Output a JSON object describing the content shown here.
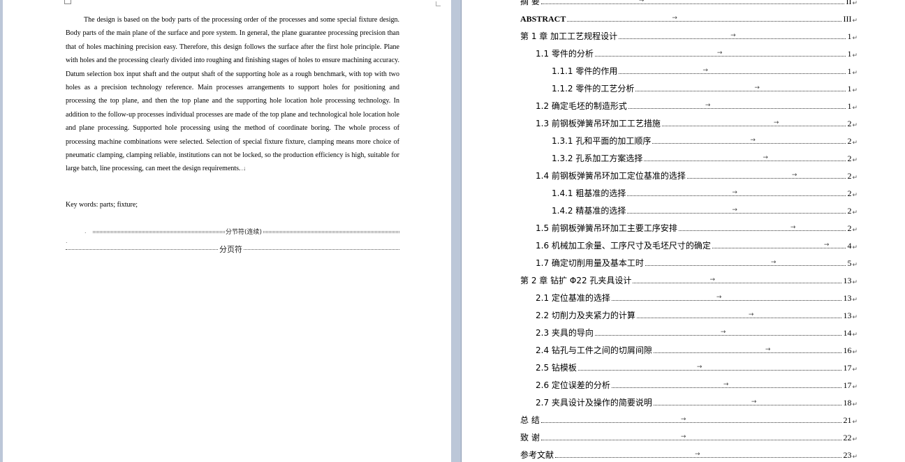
{
  "abstract": {
    "text": "The design is based on the body parts of the processing order of the processes and some special fixture design. Body parts of the main plane of the surface and pore system. In general, the plane guarantee processing precision than that of holes machining precision easy. Therefore, this design follows the surface after the first hole principle. Plane with holes and the processing clearly divided into roughing and finishing stages of holes to ensure machining accuracy. Datum selection box input shaft and the output shaft of the supporting hole as a rough benchmark, with top with two holes as a precision technology reference. Main processes arrangements to support holes for positioning and processing the top plane, and then the top plane and the supporting hole location hole processing technology. In addition to the follow-up processes individual processes are made of the top plane and technological hole location hole and plane processing. Supported hole processing using the method of coordinate boring. The whole process of processing machine combinations were selected. Selection of special fixture fixture, clamping means more choice of pneumatic clamping, clamping reliable, institutions can not be locked, so the production efficiency is high, suitable for large batch, line processing, can meet the design requirements.",
    "end_mark": ".↓"
  },
  "keywords": {
    "text": "Key words:   parts; fixture;"
  },
  "breaks": {
    "section_break": "分节符(连续)",
    "page_break": "分页符"
  },
  "toc": [
    {
      "label": "摘  要",
      "page": "II",
      "indent": 0,
      "bold": false
    },
    {
      "label": "ABSTRACT",
      "page": "III",
      "indent": 0,
      "bold": true
    },
    {
      "label": "第 1 章  加工工艺规程设计",
      "page": "1",
      "indent": 0,
      "bold": false
    },
    {
      "label": "1.1  零件的分析",
      "page": "1",
      "indent": 1,
      "bold": false
    },
    {
      "label": "1.1.1  零件的作用",
      "page": "1",
      "indent": 2,
      "bold": false
    },
    {
      "label": "1.1.2  零件的工艺分析",
      "page": "1",
      "indent": 2,
      "bold": false
    },
    {
      "label": "1.2  确定毛坯的制造形式",
      "page": "1",
      "indent": 1,
      "bold": false
    },
    {
      "label": "1.3  前钢板弹簧吊环加工工艺措施",
      "page": "2",
      "indent": 1,
      "bold": false
    },
    {
      "label": "1.3.1  孔和平面的加工顺序",
      "page": "2",
      "indent": 2,
      "bold": false
    },
    {
      "label": "1.3.2  孔系加工方案选择",
      "page": "2",
      "indent": 2,
      "bold": false
    },
    {
      "label": "1.4  前钢板弹簧吊环加工定位基准的选择",
      "page": "2",
      "indent": 1,
      "bold": false
    },
    {
      "label": "1.4.1  粗基准的选择",
      "page": "2",
      "indent": 2,
      "bold": false
    },
    {
      "label": "1.4.2  精基准的选择",
      "page": "2",
      "indent": 2,
      "bold": false
    },
    {
      "label": "1.5  前钢板弹簧吊环加工主要工序安排",
      "page": "2",
      "indent": 1,
      "bold": false
    },
    {
      "label": "1.6  机械加工余量、工序尺寸及毛坯尺寸的确定",
      "page": "4",
      "indent": 1,
      "bold": false
    },
    {
      "label": "1.7  确定切削用量及基本工时",
      "page": "5",
      "indent": 1,
      "bold": false
    },
    {
      "label": "第 2 章  钻扩 Φ22 孔夹具设计",
      "page": "13",
      "indent": 0,
      "bold": false
    },
    {
      "label": "2.1  定位基准的选择",
      "page": "13",
      "indent": 1,
      "bold": false
    },
    {
      "label": "2.2  切削力及夹紧力的计算",
      "page": "13",
      "indent": 1,
      "bold": false
    },
    {
      "label": "2.3  夹具的导向",
      "page": "14",
      "indent": 1,
      "bold": false
    },
    {
      "label": "2.4  钻孔与工件之间的切屑间隙",
      "page": "16",
      "indent": 1,
      "bold": false
    },
    {
      "label": "2.5 钻模板",
      "page": "17",
      "indent": 1,
      "bold": false
    },
    {
      "label": "2.6 定位误差的分析",
      "page": "17",
      "indent": 1,
      "bold": false
    },
    {
      "label": "2.7  夹具设计及操作的简要说明",
      "page": "18",
      "indent": 1,
      "bold": false
    },
    {
      "label": "总  结",
      "page": "21",
      "indent": 0,
      "bold": false
    },
    {
      "label": "致  谢",
      "page": "22",
      "indent": 0,
      "bold": false
    },
    {
      "label": "参考文献",
      "page": "23",
      "indent": 0,
      "bold": false
    }
  ],
  "colors": {
    "gap": "#bcc7d8",
    "page": "#ffffff",
    "text": "#000000"
  }
}
